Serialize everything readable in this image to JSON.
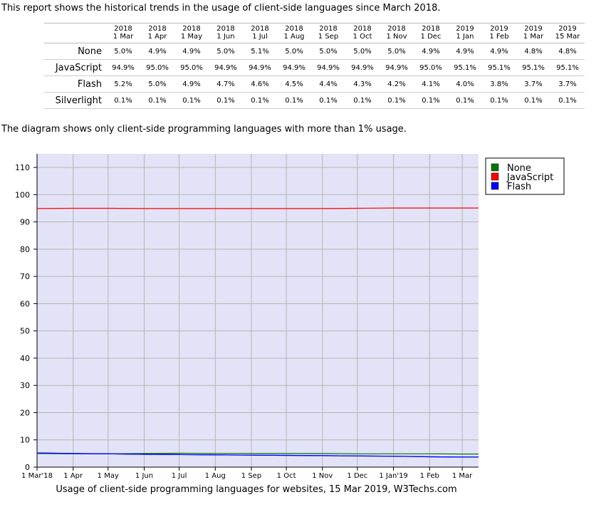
{
  "intro": "This report shows the historical trends in the usage of client-side languages since March 2018.",
  "table": {
    "columns": [
      [
        "2018",
        "1 Mar"
      ],
      [
        "2018",
        "1 Apr"
      ],
      [
        "2018",
        "1 May"
      ],
      [
        "2018",
        "1 Jun"
      ],
      [
        "2018",
        "1 Jul"
      ],
      [
        "2018",
        "1 Aug"
      ],
      [
        "2018",
        "1 Sep"
      ],
      [
        "2018",
        "1 Oct"
      ],
      [
        "2018",
        "1 Nov"
      ],
      [
        "2018",
        "1 Dec"
      ],
      [
        "2019",
        "1 Jan"
      ],
      [
        "2019",
        "1 Feb"
      ],
      [
        "2019",
        "1 Mar"
      ],
      [
        "2019",
        "15 Mar"
      ]
    ],
    "rows": [
      {
        "label": "None",
        "values": [
          "5.0%",
          "4.9%",
          "4.9%",
          "5.0%",
          "5.1%",
          "5.0%",
          "5.0%",
          "5.0%",
          "5.0%",
          "4.9%",
          "4.9%",
          "4.9%",
          "4.8%",
          "4.8%"
        ]
      },
      {
        "label": "JavaScript",
        "values": [
          "94.9%",
          "95.0%",
          "95.0%",
          "94.9%",
          "94.9%",
          "94.9%",
          "94.9%",
          "94.9%",
          "94.9%",
          "95.0%",
          "95.1%",
          "95.1%",
          "95.1%",
          "95.1%"
        ]
      },
      {
        "label": "Flash",
        "values": [
          "5.2%",
          "5.0%",
          "4.9%",
          "4.7%",
          "4.6%",
          "4.5%",
          "4.4%",
          "4.3%",
          "4.2%",
          "4.1%",
          "4.0%",
          "3.8%",
          "3.7%",
          "3.7%"
        ]
      },
      {
        "label": "Silverlight",
        "values": [
          "0.1%",
          "0.1%",
          "0.1%",
          "0.1%",
          "0.1%",
          "0.1%",
          "0.1%",
          "0.1%",
          "0.1%",
          "0.1%",
          "0.1%",
          "0.1%",
          "0.1%",
          "0.1%"
        ]
      }
    ]
  },
  "note": "The diagram shows only client-side programming languages with more than 1% usage.",
  "caption": "Usage of client-side programming languages for websites, 15 Mar 2019, W3Techs.com",
  "chart_data": {
    "type": "line",
    "title": "",
    "xlabel": "",
    "ylabel": "",
    "x": [
      "2018-03-01",
      "2018-04-01",
      "2018-05-01",
      "2018-06-01",
      "2018-07-01",
      "2018-08-01",
      "2018-09-01",
      "2018-10-01",
      "2018-11-01",
      "2018-12-01",
      "2019-01-01",
      "2019-02-01",
      "2019-03-01",
      "2019-03-15"
    ],
    "xticks": [
      "1 Mar'18",
      "1 Apr",
      "1 May",
      "1 Jun",
      "1 Jul",
      "1 Aug",
      "1 Sep",
      "1 Oct",
      "1 Nov",
      "1 Dec",
      "1 Jan'19",
      "1 Feb",
      "1 Mar"
    ],
    "xlim": [
      "2018-03-01",
      "2019-03-15"
    ],
    "ylim": [
      0,
      115
    ],
    "yticks": [
      0,
      10,
      20,
      30,
      40,
      50,
      60,
      70,
      80,
      90,
      100,
      110
    ],
    "grid": true,
    "legend": "top-right",
    "background": "#e3e3f7",
    "series": [
      {
        "name": "None",
        "color": "#007700",
        "values": [
          5.0,
          4.9,
          4.9,
          5.0,
          5.1,
          5.0,
          5.0,
          5.0,
          5.0,
          4.9,
          4.9,
          4.9,
          4.8,
          4.8
        ]
      },
      {
        "name": "JavaScript",
        "color": "#ff0000",
        "values": [
          94.9,
          95.0,
          95.0,
          94.9,
          94.9,
          94.9,
          94.9,
          94.9,
          94.9,
          95.0,
          95.1,
          95.1,
          95.1,
          95.1
        ]
      },
      {
        "name": "Flash",
        "color": "#0000ff",
        "values": [
          5.2,
          5.0,
          4.9,
          4.7,
          4.6,
          4.5,
          4.4,
          4.3,
          4.2,
          4.1,
          4.0,
          3.8,
          3.7,
          3.7
        ]
      }
    ]
  }
}
